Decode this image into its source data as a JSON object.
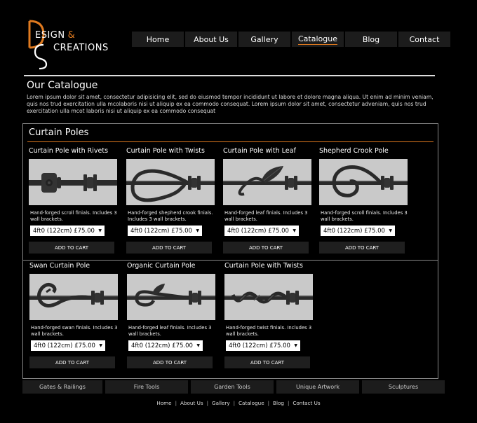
{
  "logo": {
    "line1": "ESIGN",
    "amp": "&",
    "line2": "CREATIONS"
  },
  "nav": [
    {
      "label": "Home",
      "active": false
    },
    {
      "label": "About Us",
      "active": false
    },
    {
      "label": "Gallery",
      "active": false
    },
    {
      "label": "Catalogue",
      "active": true
    },
    {
      "label": "Blog",
      "active": false
    },
    {
      "label": "Contact",
      "active": false
    }
  ],
  "page": {
    "title": "Our Catalogue",
    "intro": "Lorem ipsum dolor sit amet, consectetur adipisicing elit, sed do eiusmod tempor incididunt ut labore et dolore magna aliqua. Ut enim ad minim veniam, quis nos trud exercitation ulla  mcolaboris nisi ut aliquip ex ea commodo consequat.  Lorem ipsum dolor sit amet, consectetur adveniam, quis nos trud exercitation ulla  mcot laboris nisi ut aliquip ex ea commodo consequat"
  },
  "section": {
    "title": "Curtain Poles",
    "products": [
      {
        "name": "Curtain Pole with Rivets",
        "desc": "Hand-forged scroll finials. Includes 3 wall brackets.",
        "option": "4ft0 (122cm) £75.00",
        "button": "ADD TO CART",
        "image": "rivets"
      },
      {
        "name": "Curtain Pole with Twists",
        "desc": "Hand-forged shepherd crook finials. Includes 3 wall brackets.",
        "option": "4ft0 (122cm) £75.00",
        "button": "ADD TO CART",
        "image": "crook"
      },
      {
        "name": "Curtain Pole with Leaf",
        "desc": "Hand-forged leaf finials. Includes 3 wall brackets.",
        "option": "4ft0 (122cm) £75.00",
        "button": "ADD TO CART",
        "image": "leaf"
      },
      {
        "name": "Shepherd Crook Pole",
        "desc": "Hand-forged scroll finials. Includes 3 wall brackets.",
        "option": "4ft0 (122cm) £75.00",
        "button": "ADD TO CART",
        "image": "scroll"
      },
      {
        "name": "Swan Curtain Pole",
        "desc": "Hand-forged swan finials. Includes 3 wall brackets.",
        "option": "4ft0 (122cm) £75.00",
        "button": "ADD TO CART",
        "image": "swan"
      },
      {
        "name": "Organic Curtain Pole",
        "desc": "Hand-forged leaf finials. Includes 3 wall brackets.",
        "option": "4ft0 (122cm) £75.00",
        "button": "ADD TO CART",
        "image": "organic"
      },
      {
        "name": "Curtain Pole with Twists",
        "desc": "Hand-forged twist finials. Includes 3 wall brackets.",
        "option": "4ft0 (122cm) £75.00",
        "button": "ADD TO CART",
        "image": "twist"
      }
    ]
  },
  "categories": [
    "Gates & Railings",
    "Fire Tools",
    "Garden Tools",
    "Unique Artwork",
    "Sculptures"
  ],
  "footer": [
    "Home",
    "About Us",
    "Gallery",
    "Catalogue",
    "Blog",
    "Contact Us"
  ],
  "colors": {
    "accent": "#e07a1f",
    "background": "#000000",
    "button": "#1f1f1f"
  }
}
